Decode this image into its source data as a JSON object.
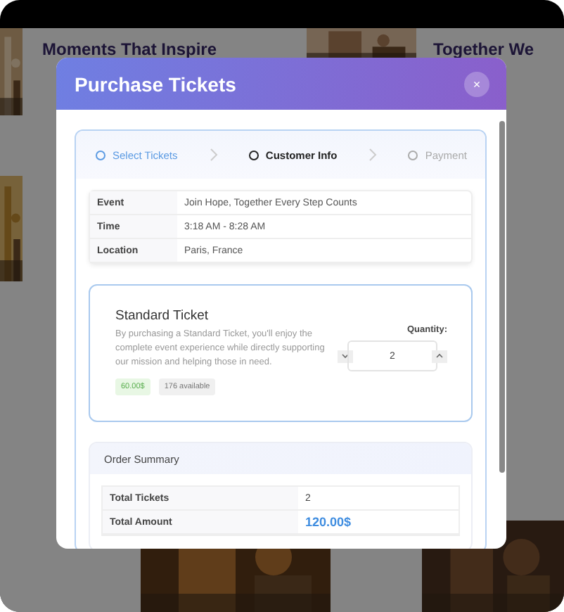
{
  "background": {
    "cards": [
      {
        "title": "Moments That Inspire"
      },
      {
        "title": "Together We"
      }
    ]
  },
  "dialog": {
    "title": "Purchase Tickets",
    "close": "×",
    "steps": [
      {
        "label": "Select Tickets",
        "completed": true,
        "selected": false
      },
      {
        "label": "Customer Info",
        "completed": false,
        "selected": true
      },
      {
        "label": "Payment",
        "completed": false,
        "selected": false
      }
    ],
    "details": [
      {
        "label": "Event",
        "value": "Join Hope, Together Every Step Counts"
      },
      {
        "label": "Time",
        "value": "3:18 AM - 8:28 AM"
      },
      {
        "label": "Location",
        "value": "Paris, France"
      }
    ],
    "ticket": {
      "name": "Standard Ticket",
      "description": "By purchasing a Standard Ticket, you'll enjoy the complete event experience while directly supporting our mission and helping those in need.",
      "price": "60.00$",
      "availability": "176 available",
      "quantity_label": "Quantity:",
      "quantity": "2"
    },
    "summary": {
      "title": "Order Summary",
      "rows": [
        {
          "label": "Total Tickets",
          "value": "2",
          "kind": "plain"
        },
        {
          "label": "Total Amount",
          "value": "120.00$",
          "kind": "total"
        }
      ]
    }
  }
}
